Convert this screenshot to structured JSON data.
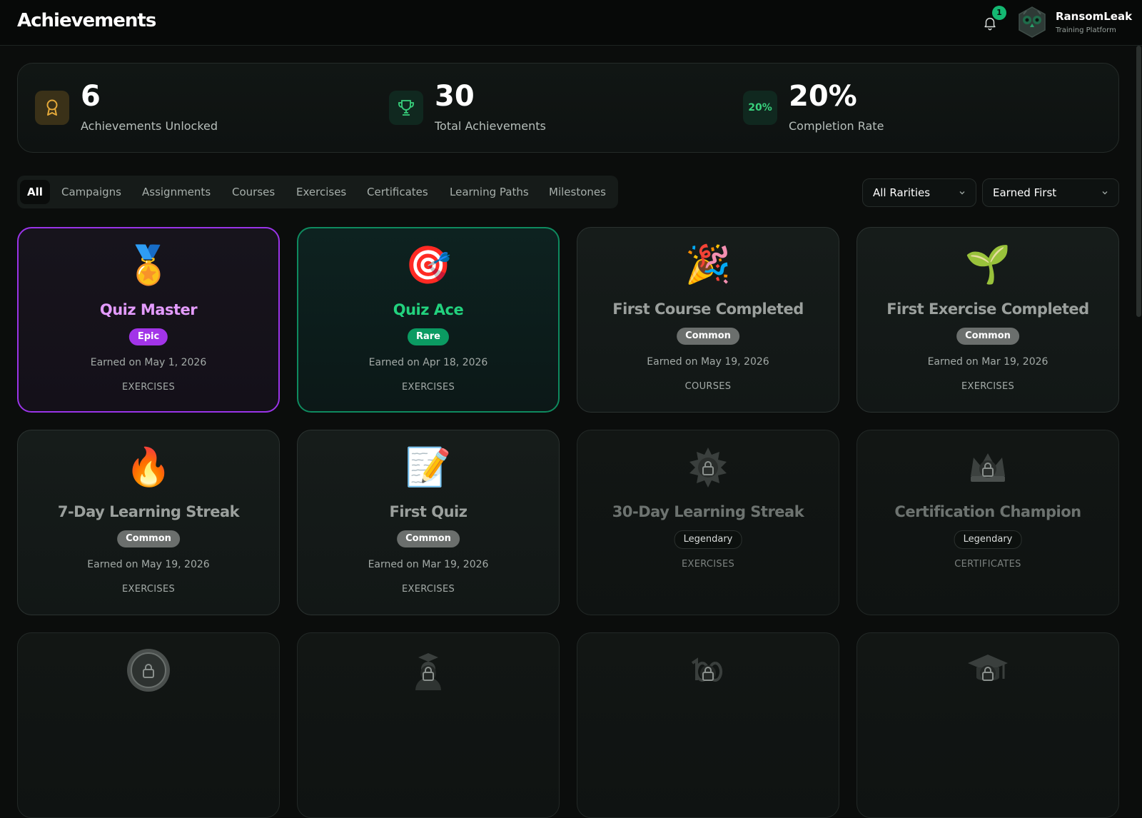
{
  "header": {
    "title": "Achievements",
    "notification_count": "1",
    "brand_name": "RansomLeak",
    "brand_subtitle": "Training Platform"
  },
  "stats": [
    {
      "value": "6",
      "label": "Achievements Unlocked",
      "icon": "medal-icon"
    },
    {
      "value": "30",
      "label": "Total Achievements",
      "icon": "trophy-icon"
    },
    {
      "value": "20%",
      "label": "Completion Rate",
      "icon_text": "20%"
    }
  ],
  "tabs": [
    {
      "label": "All",
      "active": true
    },
    {
      "label": "Campaigns"
    },
    {
      "label": "Assignments"
    },
    {
      "label": "Courses"
    },
    {
      "label": "Exercises"
    },
    {
      "label": "Certificates"
    },
    {
      "label": "Learning Paths"
    },
    {
      "label": "Milestones"
    }
  ],
  "filters": {
    "rarity": "All Rarities",
    "sort": "Earned First"
  },
  "cards": [
    {
      "title": "Quiz Master",
      "rarity": "Epic",
      "earned": "Earned on May 1, 2026",
      "category": "EXERCISES",
      "icon": "🏅"
    },
    {
      "title": "Quiz Ace",
      "rarity": "Rare",
      "earned": "Earned on Apr 18, 2026",
      "category": "EXERCISES",
      "icon": "🎯"
    },
    {
      "title": "First Course Completed",
      "rarity": "Common",
      "earned": "Earned on May 19, 2026",
      "category": "COURSES",
      "icon": "🎉"
    },
    {
      "title": "First Exercise Completed",
      "rarity": "Common",
      "earned": "Earned on Mar 19, 2026",
      "category": "EXERCISES",
      "icon": "🌱"
    },
    {
      "title": "7-Day Learning Streak",
      "rarity": "Common",
      "earned": "Earned on May 19, 2026",
      "category": "EXERCISES",
      "icon": "🔥"
    },
    {
      "title": "First Quiz",
      "rarity": "Common",
      "earned": "Earned on Mar 19, 2026",
      "category": "EXERCISES",
      "icon": "📝"
    },
    {
      "title": "30-Day Learning Streak",
      "rarity": "Legendary",
      "category": "EXERCISES",
      "locked": true
    },
    {
      "title": "Certification Champion",
      "rarity": "Legendary",
      "category": "CERTIFICATES",
      "locked": true
    }
  ],
  "colors": {
    "epic": "#a234e8",
    "rare": "#0b9b62",
    "accent_green": "#14b872",
    "background": "#0b0d0c"
  }
}
